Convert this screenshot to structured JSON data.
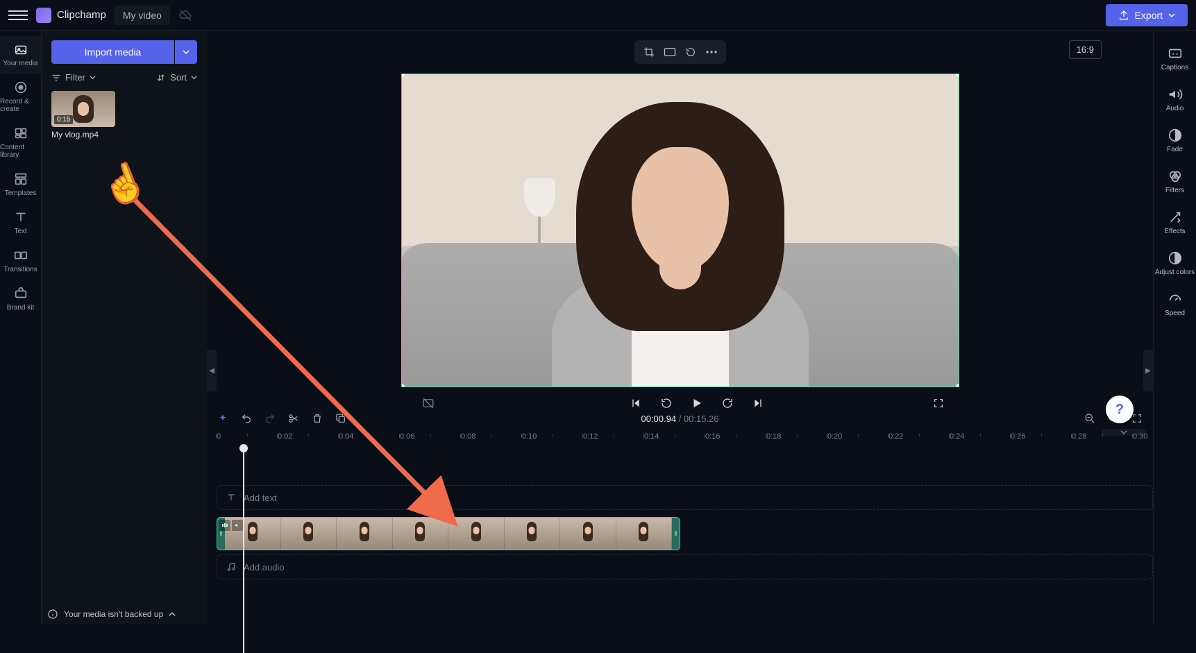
{
  "header": {
    "brand": "Clipchamp",
    "project_name": "My video",
    "export_label": "Export"
  },
  "nav_rail": {
    "your_media": "Your media",
    "record_create": "Record & create",
    "content_library": "Content library",
    "templates": "Templates",
    "text": "Text",
    "transitions": "Transitions",
    "brand_kit": "Brand kit"
  },
  "media_panel": {
    "import_label": "Import media",
    "filter_label": "Filter",
    "sort_label": "Sort",
    "thumb": {
      "duration": "0:15",
      "filename": "My vlog.mp4"
    }
  },
  "preview": {
    "aspect": "16:9"
  },
  "prop_rail": {
    "captions": "Captions",
    "audio": "Audio",
    "fade": "Fade",
    "filters": "Filters",
    "effects": "Effects",
    "adjust_colors": "Adjust colors",
    "speed": "Speed"
  },
  "timeline": {
    "current_time": "00:00.94",
    "total_time": "00:15.26",
    "add_text": "Add text",
    "add_audio": "Add audio",
    "ruler": [
      "0",
      "0:02",
      "0:04",
      "0:06",
      "0:08",
      "0:10",
      "0:12",
      "0:14",
      "0:16",
      "0:18",
      "0:20",
      "0:22",
      "0:24",
      "0:26",
      "0:28",
      "0:30"
    ]
  },
  "footer": {
    "backup_msg": "Your media isn't backed up"
  }
}
